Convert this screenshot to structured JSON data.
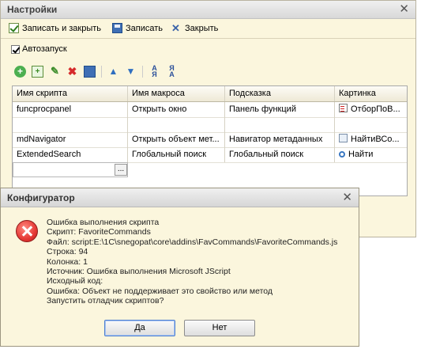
{
  "settings": {
    "title": "Настройки",
    "commands": {
      "save_close": "Записать и закрыть",
      "save": "Записать",
      "close": "Закрыть"
    },
    "autostart_label": "Автозапуск",
    "table": {
      "headers": [
        "Имя скрипта",
        "Имя макроса",
        "Подсказка",
        "Картинка"
      ],
      "rows": [
        {
          "script": "funcprocpanel",
          "macro": "Открыть окно",
          "hint": "Панель функций",
          "picture": "ОтборПоВ..."
        },
        {
          "script": "",
          "macro": "",
          "hint": "",
          "picture": ""
        },
        {
          "script": "mdNavigator",
          "macro": "Открыть объект мет...",
          "hint": "Навигатор метаданных",
          "picture": "НайтиВСо..."
        },
        {
          "script": "ExtendedSearch",
          "macro": "Глобальный поиск",
          "hint": "Глобальный поиск",
          "picture": "Найти"
        }
      ],
      "edit_button": "..."
    }
  },
  "dialog": {
    "title": "Конфигуратор",
    "lines": [
      "Ошибка выполнения скрипта",
      "Скрипт: FavoriteCommands",
      "Файл: script:E:\\1C\\snegopat\\core\\addins\\FavCommands\\FavoriteCommands.js",
      "Строка: 94",
      "Колонка: 1",
      "Источник: Ошибка выполнения Microsoft JScript",
      "Исходный код:",
      "Ошибка: Объект не поддерживает это свойство или метод",
      "Запустить отладчик скриптов?"
    ],
    "yes": "Да",
    "no": "Нет"
  },
  "background_fragment": "2"
}
